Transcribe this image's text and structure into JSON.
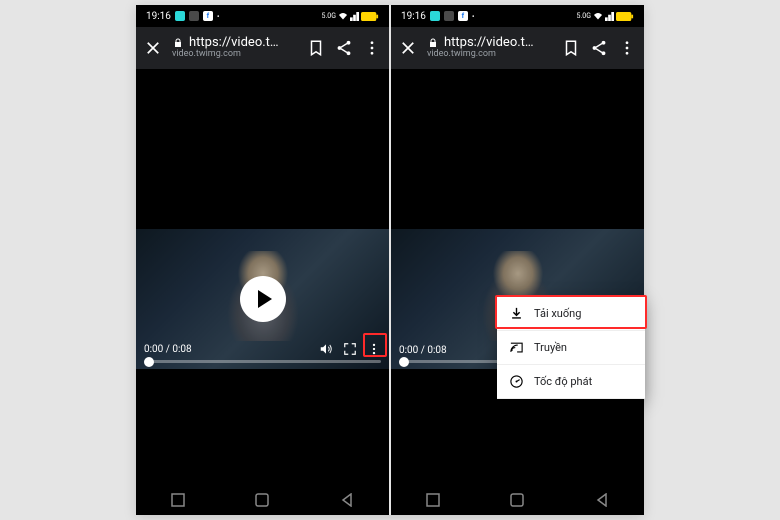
{
  "status": {
    "time": "19:16",
    "signal_label": "5.0G",
    "battery_color": "#ffd400"
  },
  "browser": {
    "url_display": "https://video.t…",
    "subdomain": "video.twimg.com"
  },
  "video": {
    "current_time": "0:00",
    "duration": "0:08"
  },
  "menu": {
    "download": "Tải xuống",
    "cast": "Truyền",
    "speed": "Tốc độ phát"
  },
  "colors": {
    "highlight": "#ff2a2a"
  },
  "app_chips": {
    "messenger_color": "#2bd8d8",
    "unknown_color": "#4a4a4a",
    "facebook_color": "#ffffff"
  }
}
